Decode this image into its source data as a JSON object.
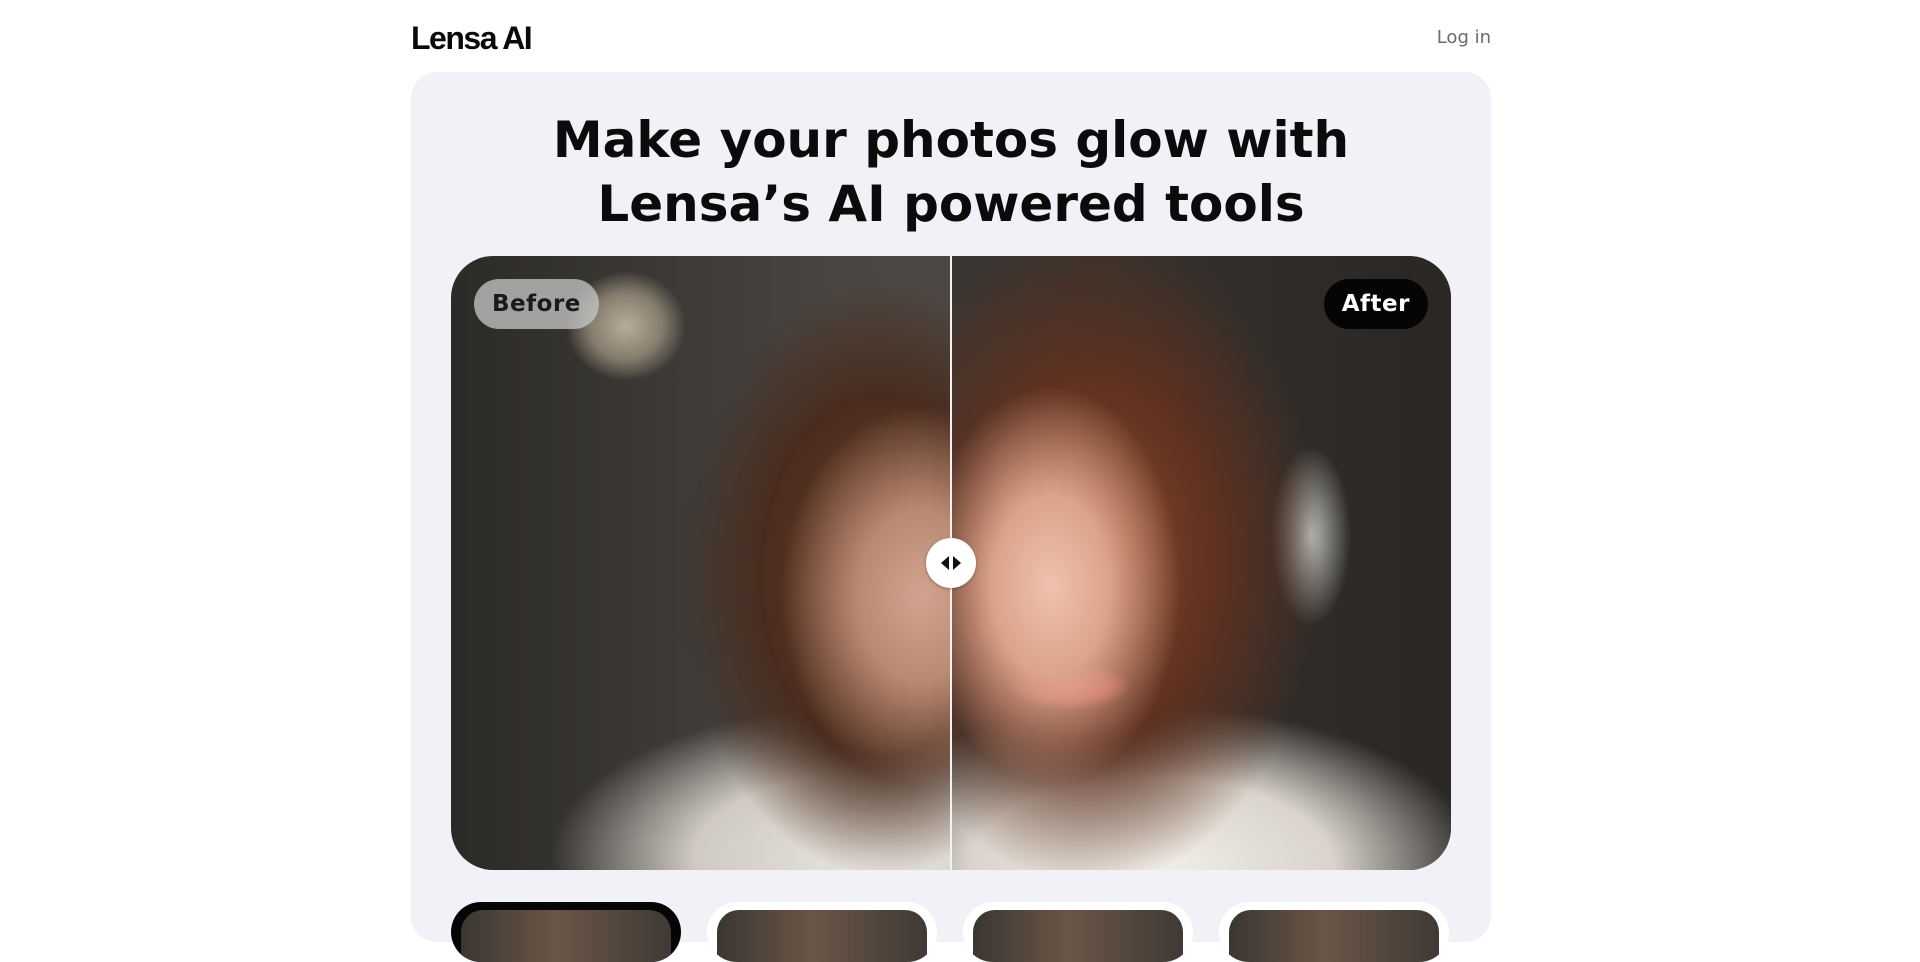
{
  "header": {
    "logo": "Lensa AI",
    "login_label": "Log in"
  },
  "hero": {
    "headline_line1": "Make your photos glow with",
    "headline_line2": "Lensa’s AI powered tools"
  },
  "comparison": {
    "before_label": "Before",
    "after_label": "After",
    "slider_position": 0.5
  },
  "thumbnails": {
    "count": 4,
    "active_index": 0
  },
  "colors": {
    "panel_bg": "#f2f1f7",
    "after_badge_bg": "#050505",
    "before_badge_bg": "#c8c8c8"
  },
  "icons": {
    "handle": "arrows-left-right-icon"
  }
}
